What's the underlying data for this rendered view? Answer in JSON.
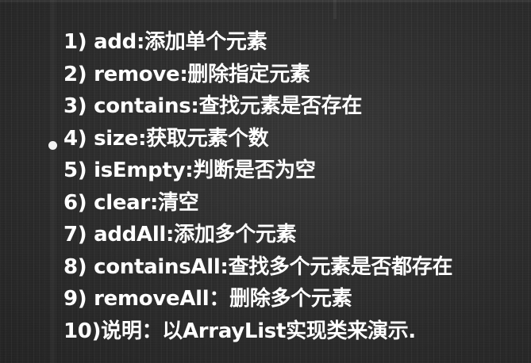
{
  "lines": [
    "1) add:添加单个元素",
    "2) remove:删除指定元素",
    "3) contains:查找元素是否存在",
    "4) size:获取元素个数",
    "5) isEmpty:判断是否为空",
    "6) clear:清空",
    "7) addAll:添加多个元素",
    "8) containsAll:查找多个元素是否都存在",
    "9) removeAll：删除多个元素",
    "10)说明：以ArrayList实现类来演示."
  ],
  "colors": {
    "background": "#2e2e2e",
    "text": "#ffffff",
    "bullet": "#f2f2f2"
  }
}
